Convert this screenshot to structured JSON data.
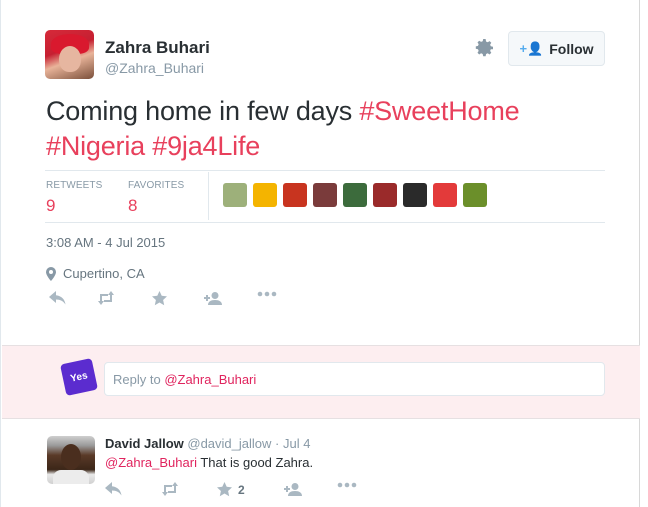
{
  "tweet": {
    "author_name": "Zahra Buhari",
    "author_handle": "@Zahra_Buhari",
    "follow_label": "Follow",
    "text_plain": "Coming home in few days",
    "hashtags": [
      "#SweetHome",
      "#Nigeria",
      "#9ja4Life"
    ],
    "stats": {
      "retweets_label": "RETWEETS",
      "retweets_value": "9",
      "favorites_label": "FAVORITES",
      "favorites_value": "8"
    },
    "timestamp": "3:08 AM - 4 Jul 2015",
    "location": "Cupertino, CA"
  },
  "favoriters": [
    "#9db07a",
    "#f4b400",
    "#c8341f",
    "#7a3b3b",
    "#3c6b3c",
    "#9a2a2a",
    "#2a2a2a",
    "#e33a3a",
    "#6b8f2a"
  ],
  "reply_box": {
    "placeholder_prefix": "Reply to ",
    "placeholder_handle": "@Zahra_Buhari",
    "avatar_text": "Yes"
  },
  "reply": {
    "author_name": "David Jallow",
    "author_handle": "@david_jallow",
    "time": "· Jul 4",
    "mention": "@Zahra_Buhari",
    "text": "That is good Zahra.",
    "favorite_count": "2"
  },
  "colors": {
    "hashtag": "#e8405c",
    "icon": "#aab8c2",
    "reply_area_bg": "#fdeef0"
  }
}
